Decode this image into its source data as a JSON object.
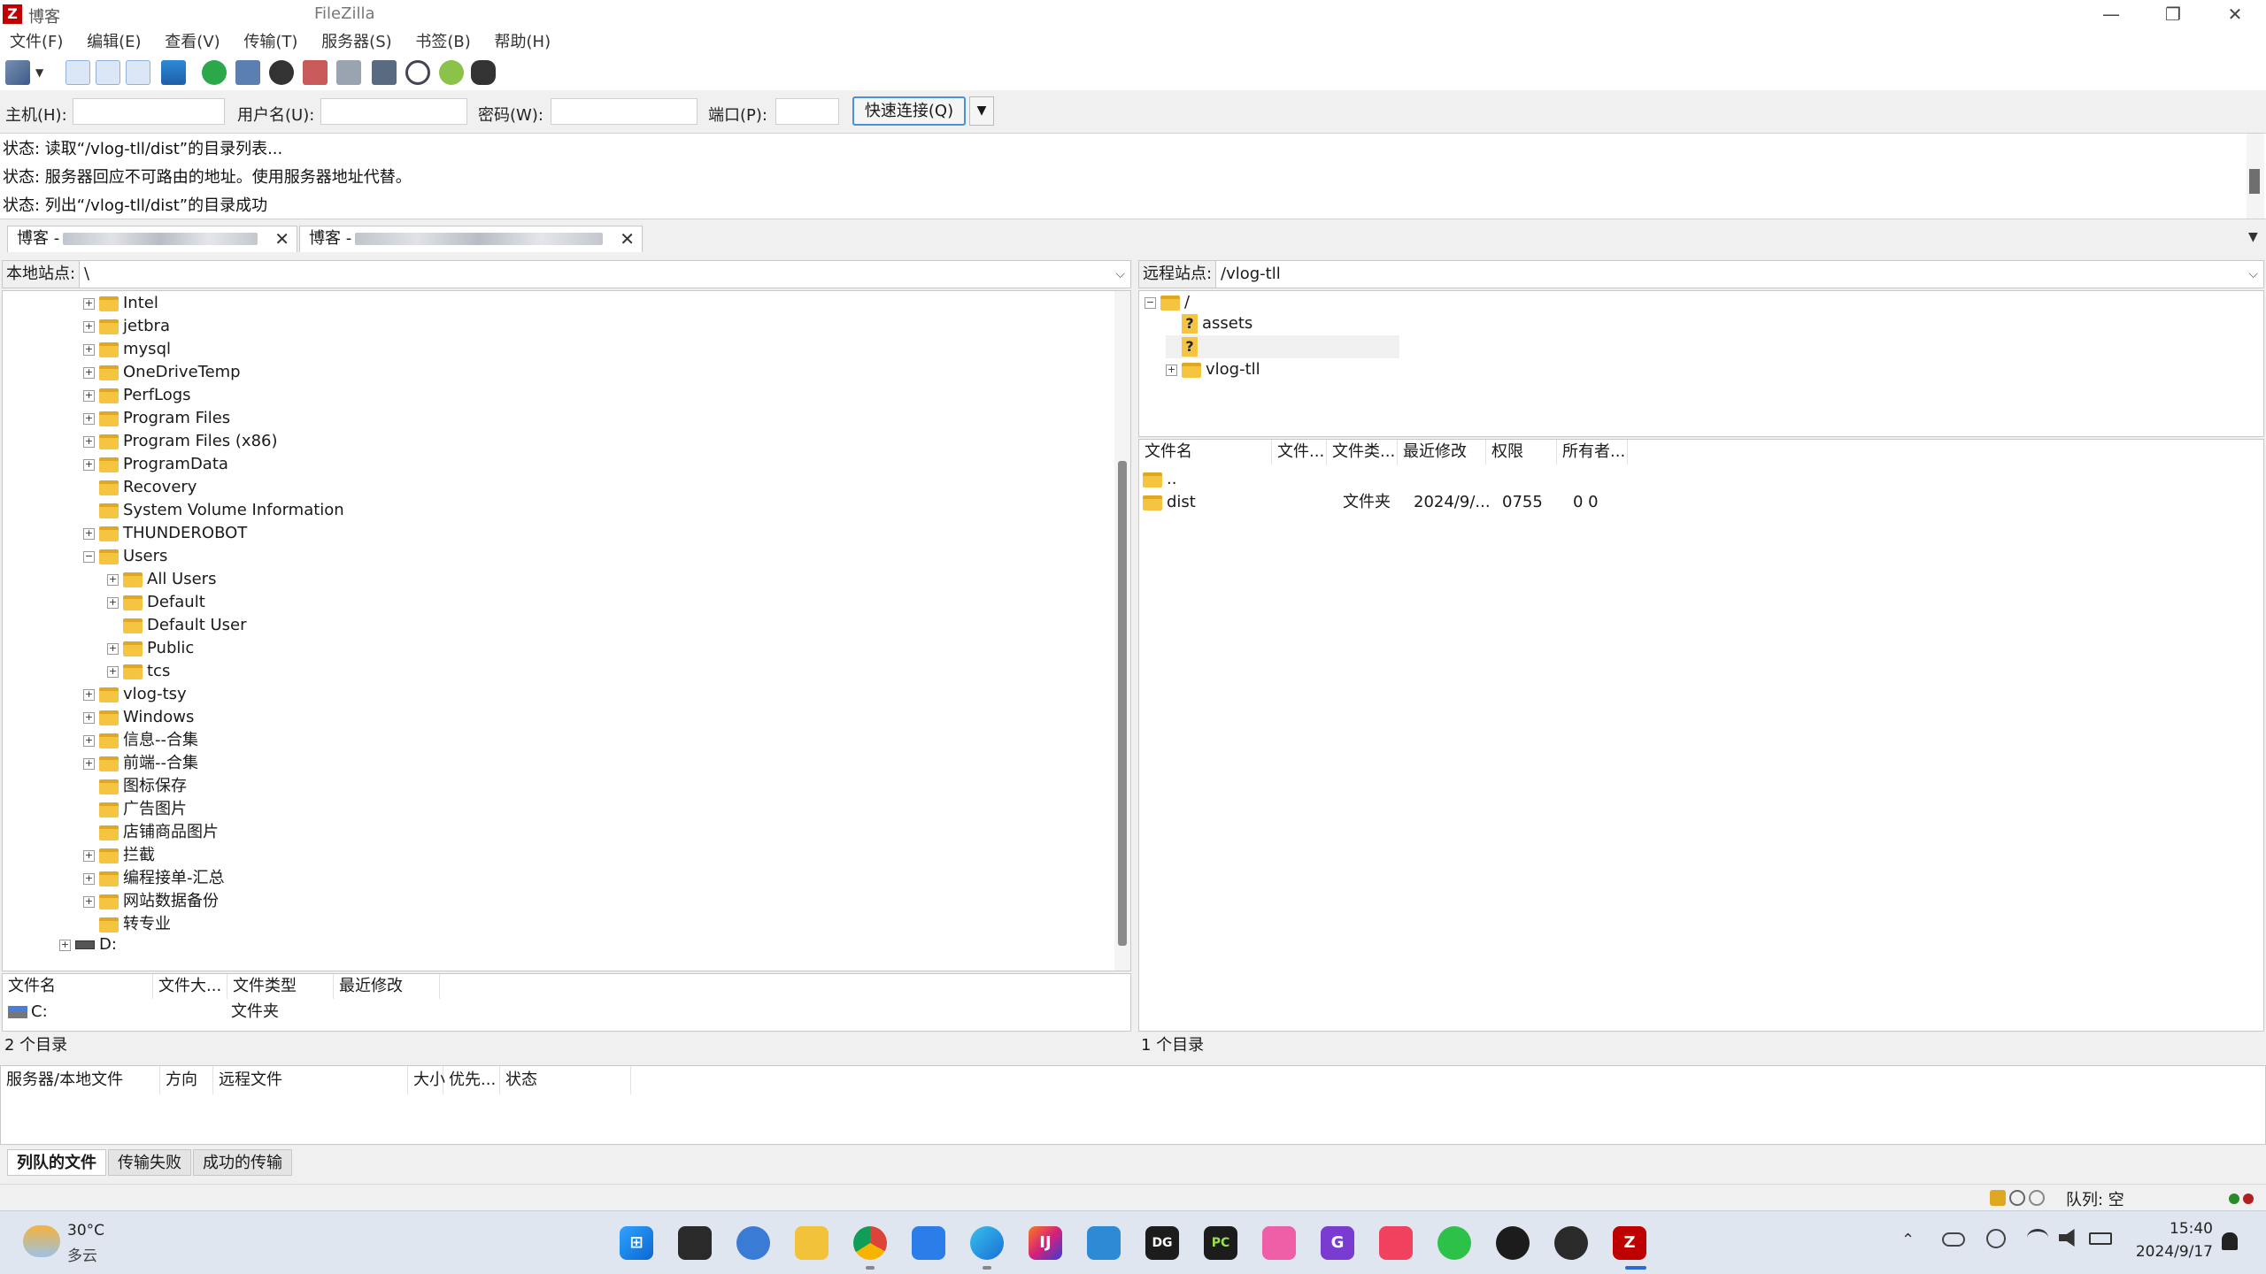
{
  "window": {
    "site_title": "博客",
    "app_title": "FileZilla",
    "minimize": "—",
    "restore": "❐",
    "close": "✕"
  },
  "menu": [
    "文件(F)",
    "编辑(E)",
    "查看(V)",
    "传输(T)",
    "服务器(S)",
    "书签(B)",
    "帮助(H)"
  ],
  "quickconnect": {
    "host_label": "主机(H):",
    "user_label": "用户名(U):",
    "pass_label": "密码(W):",
    "port_label": "端口(P):",
    "connect_label": "快速连接(Q)",
    "dropdown": "▼",
    "host_value": "",
    "user_value": "",
    "pass_value": "",
    "port_value": ""
  },
  "log": [
    "状态: 读取“/vlog-tll/dist”的目录列表...",
    "状态: 服务器回应不可路由的地址。使用服务器地址代替。",
    "状态: 列出“/vlog-tll/dist”的目录成功"
  ],
  "tabs": [
    {
      "label": "博客 -",
      "close": "✕"
    },
    {
      "label": "博客 -",
      "close": "✕"
    }
  ],
  "local": {
    "site_label": "本地站点:",
    "path": "\\",
    "tree": [
      {
        "name": "Intel",
        "exp": "+"
      },
      {
        "name": "jetbra",
        "exp": "+"
      },
      {
        "name": "mysql",
        "exp": "+"
      },
      {
        "name": "OneDriveTemp",
        "exp": "+"
      },
      {
        "name": "PerfLogs",
        "exp": "+"
      },
      {
        "name": "Program Files",
        "exp": "+"
      },
      {
        "name": "Program Files (x86)",
        "exp": "+"
      },
      {
        "name": "ProgramData",
        "exp": "+"
      },
      {
        "name": "Recovery",
        "exp": ""
      },
      {
        "name": "System Volume Information",
        "exp": ""
      },
      {
        "name": "THUNDEROBOT",
        "exp": "+"
      },
      {
        "name": "Users",
        "exp": "−"
      },
      {
        "name": "All Users",
        "exp": "+",
        "indent": 1
      },
      {
        "name": "Default",
        "exp": "+",
        "indent": 1
      },
      {
        "name": "Default User",
        "exp": "",
        "indent": 1
      },
      {
        "name": "Public",
        "exp": "+",
        "indent": 1
      },
      {
        "name": "tcs",
        "exp": "+",
        "indent": 1
      },
      {
        "name": "vlog-tsy",
        "exp": "+"
      },
      {
        "name": "Windows",
        "exp": "+"
      },
      {
        "name": "信息--合集",
        "exp": "+"
      },
      {
        "name": "前端--合集",
        "exp": "+"
      },
      {
        "name": "图标保存",
        "exp": ""
      },
      {
        "name": "广告图片",
        "exp": ""
      },
      {
        "name": "店铺商品图片",
        "exp": ""
      },
      {
        "name": "拦截",
        "exp": "+"
      },
      {
        "name": "编程接单-汇总",
        "exp": "+"
      },
      {
        "name": "网站数据备份",
        "exp": "+"
      },
      {
        "name": "转专业",
        "exp": ""
      }
    ],
    "drive_d": "D:",
    "columns": [
      "文件名",
      "文件大...",
      "文件类型",
      "最近修改"
    ],
    "rows": [
      {
        "name": "C:",
        "type": "文件夹"
      }
    ],
    "status": "2 个目录"
  },
  "remote": {
    "site_label": "远程站点:",
    "path": "/vlog-tll",
    "tree_root": "/",
    "tree": [
      {
        "name": "assets",
        "icon": "?"
      },
      {
        "name": "",
        "icon": "?"
      },
      {
        "name": "vlog-tll",
        "icon": "folder"
      }
    ],
    "columns": [
      "文件名",
      "文件...",
      "文件类...",
      "最近修改",
      "权限",
      "所有者..."
    ],
    "rows": [
      {
        "name": "..",
        "size": "",
        "type": "",
        "modified": "",
        "perm": "",
        "owner": ""
      },
      {
        "name": "dist",
        "size": "",
        "type": "文件夹",
        "modified": "2024/9/...",
        "perm": "0755",
        "owner": "0 0"
      }
    ],
    "status": "1 个目录"
  },
  "queue": {
    "columns": [
      "服务器/本地文件",
      "方向",
      "远程文件",
      "大小",
      "优先...",
      "状态"
    ],
    "tabs": [
      "列队的文件",
      "传输失败",
      "成功的传输"
    ]
  },
  "statusbar": {
    "queue": "队列: 空"
  },
  "taskbar": {
    "weather_temp": "30°C",
    "weather_desc": "多云",
    "time": "15:40",
    "date": "2024/9/17"
  }
}
